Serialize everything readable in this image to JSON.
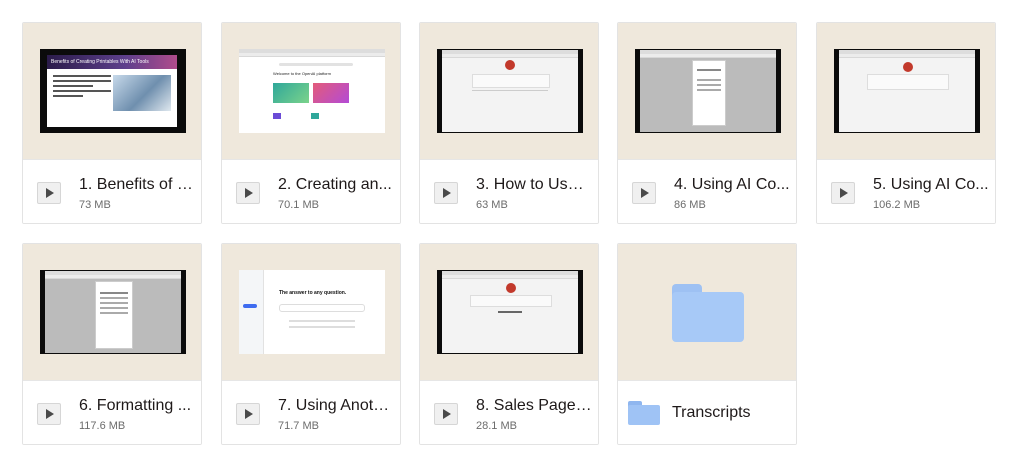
{
  "items": [
    {
      "title": "1. Benefits of U...",
      "size": "73 MB",
      "slide_title": "Benefits of Creating Printables With AI Tools"
    },
    {
      "title": "2. Creating an...",
      "size": "70.1 MB",
      "screen_heading": "Welcome to the OpenAI platform"
    },
    {
      "title": "3. How to Use ...",
      "size": "63 MB"
    },
    {
      "title": "4. Using AI Co...",
      "size": "86 MB"
    },
    {
      "title": "5. Using AI Co...",
      "size": "106.2 MB"
    },
    {
      "title": "6. Formatting ...",
      "size": "117.6 MB"
    },
    {
      "title": "7. Using Anoth...",
      "size": "71.7 MB",
      "screen_heading": "The answer to any question."
    },
    {
      "title": "8. Sales Page ...",
      "size": "28.1 MB"
    }
  ],
  "folder": {
    "title": "Transcripts"
  },
  "icons": {
    "play": "play-icon",
    "folder": "folder-icon"
  },
  "colors": {
    "thumb_bg": "#efe8dc",
    "folder_blue": "#a7c9f7"
  }
}
